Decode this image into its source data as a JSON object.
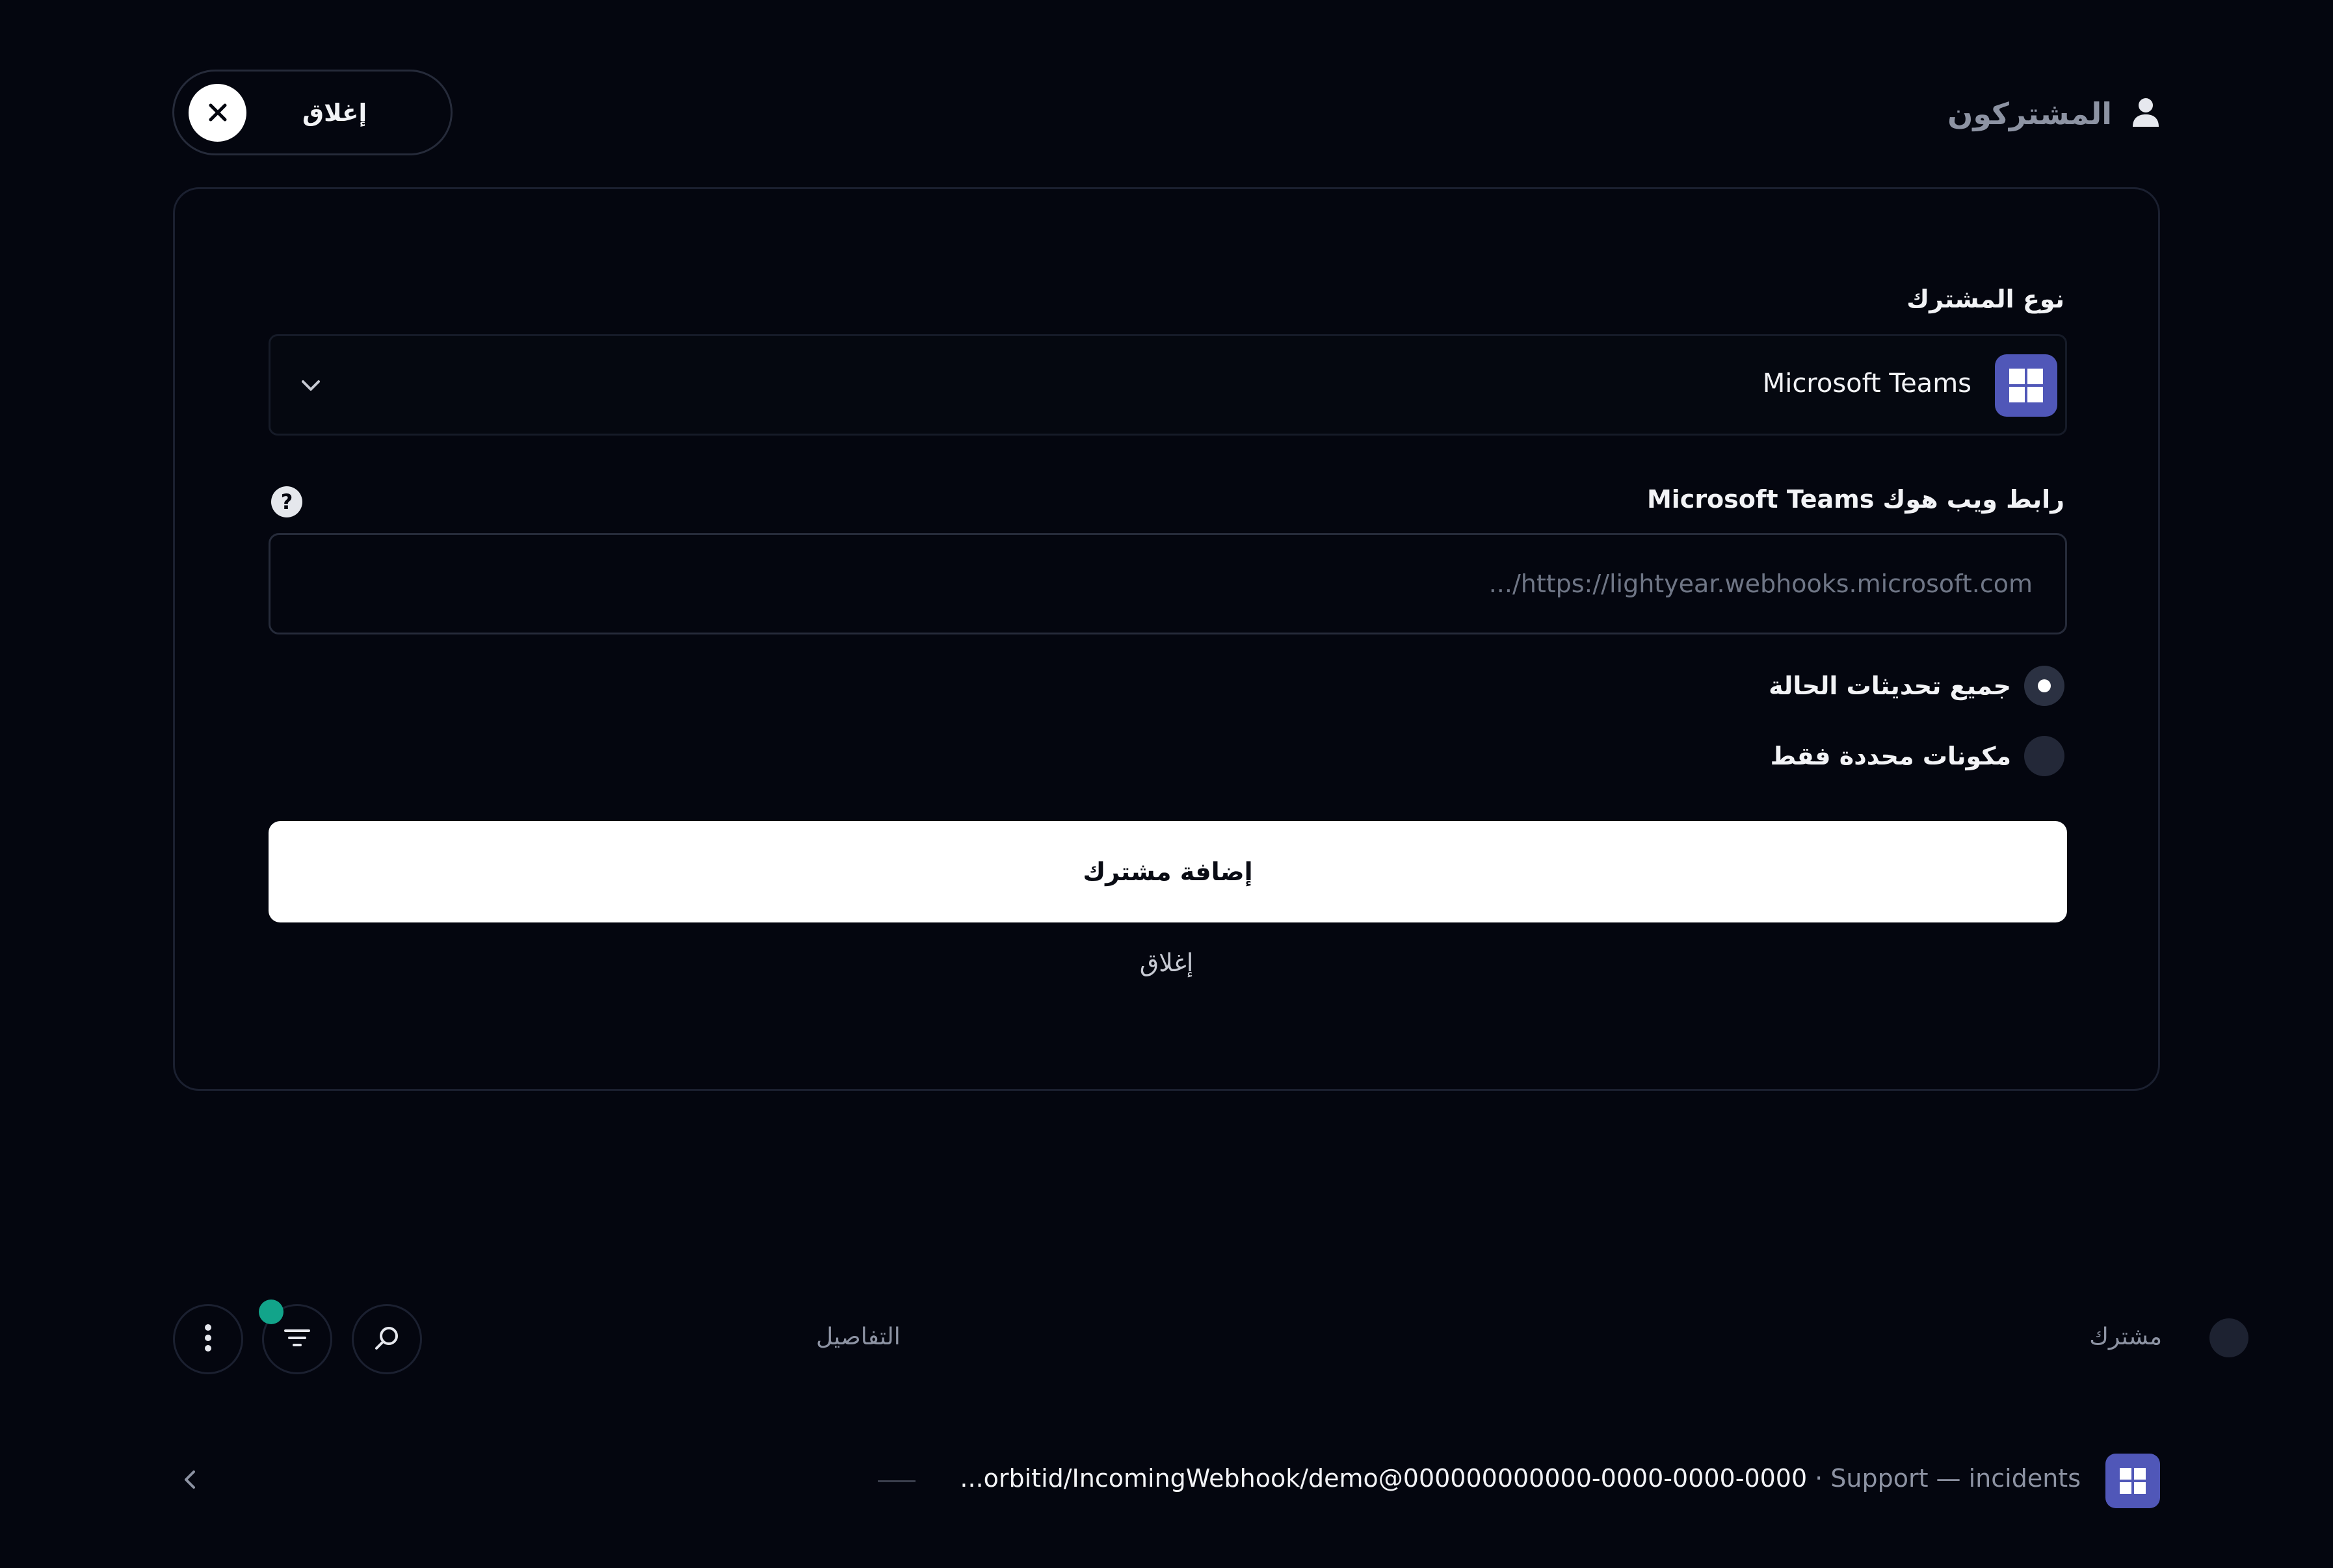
{
  "header": {
    "title": "المشتركون",
    "title_icon": "user-icon",
    "close_label": "إغلاق",
    "close_icon": "x-icon"
  },
  "form": {
    "subscriber_type_label": "نوع المشترك",
    "subscriber_type_value": "Microsoft Teams",
    "subscriber_type_icon": "microsoft-windows-icon",
    "webhook_label": "رابط ويب هوك Microsoft Teams",
    "webhook_placeholder": "https://lightyear.webhooks.microsoft.com/...",
    "webhook_value": "",
    "help_glyph": "?",
    "radio_options": [
      {
        "label": "جميع تحديثات الحالة",
        "checked": true
      },
      {
        "label": "مكونات محددة فقط",
        "checked": false
      }
    ],
    "submit_label": "إضافة مشترك",
    "cancel_label": "إغلاق"
  },
  "toolbar": {
    "search_icon": "search-icon",
    "filter_icon": "filter-icon",
    "more_icon": "more-vertical-icon",
    "filter_active_color": "#12a48a"
  },
  "table": {
    "headers": {
      "subscriber": "مشترك",
      "details": "التفاصيل"
    },
    "rows": [
      {
        "icon": "microsoft-windows-icon",
        "url": "orbitid/IncomingWebhook/demo@000000000000-0000-0000-0000...",
        "separator": "·",
        "description": "Support — incidents",
        "dash": "—"
      }
    ]
  },
  "colors": {
    "background": "#04060f",
    "teams_purple": "#5057b8",
    "primary_button": "#ffffff",
    "muted_text": "#8d93a3"
  }
}
